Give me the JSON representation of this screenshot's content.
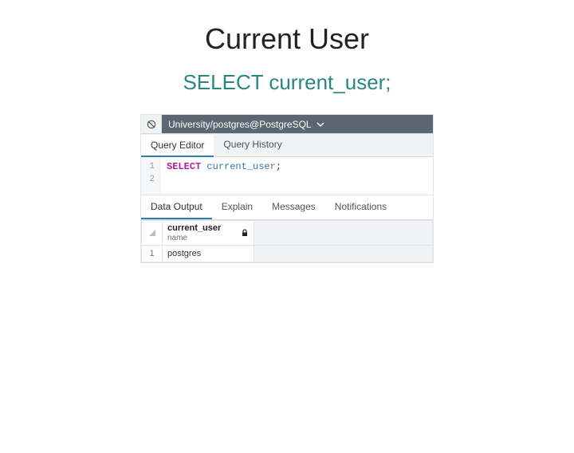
{
  "slide": {
    "title": "Current User",
    "sql": "SELECT current_user;"
  },
  "pgadmin": {
    "connection": "University/postgres@PostgreSQL",
    "tabs": {
      "editor": "Query Editor",
      "history": "Query History"
    },
    "editor": {
      "lines": {
        "l1": "1",
        "l2": "2"
      },
      "kw": "SELECT",
      "ident": "current_user",
      "punct": ";"
    },
    "outputTabs": {
      "data": "Data Output",
      "explain": "Explain",
      "messages": "Messages",
      "notifications": "Notifications"
    },
    "result": {
      "col1": {
        "name": "current_user",
        "type": "name"
      },
      "rows": {
        "r1": {
          "num": "1",
          "val": "postgres"
        }
      }
    }
  }
}
